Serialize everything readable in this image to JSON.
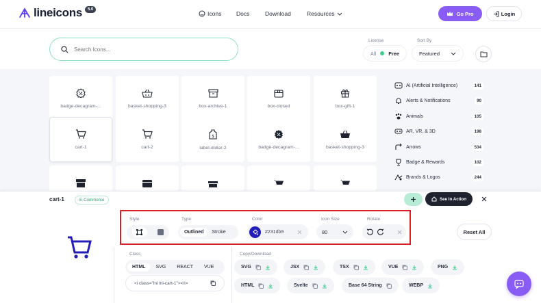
{
  "header": {
    "logo_text": "lineicons",
    "version": "5.0",
    "nav": {
      "icons": "Icons",
      "docs": "Docs",
      "download": "Download",
      "resources": "Resources"
    },
    "go_pro": "Go Pro",
    "login": "Login"
  },
  "search": {
    "placeholder": "Search Icons..."
  },
  "filters": {
    "license_label": "License",
    "license_all": "All",
    "license_free": "Free",
    "sort_label": "Sort By",
    "sort_value": "Featured"
  },
  "tiles": [
    {
      "name": "badge-decagram-...",
      "icon": "badge-percent-icon"
    },
    {
      "name": "basket-shopping-3",
      "icon": "basket-icon"
    },
    {
      "name": "box-archive-1",
      "icon": "archive-icon"
    },
    {
      "name": "box-closed",
      "icon": "box-closed-icon"
    },
    {
      "name": "box-gift-1",
      "icon": "gift-icon"
    },
    {
      "name": "cart-1",
      "icon": "cart-icon"
    },
    {
      "name": "cart-2",
      "icon": "cart-icon"
    },
    {
      "name": "label-dollar-2",
      "icon": "label-dollar-icon"
    },
    {
      "name": "badge-decagram-...",
      "icon": "badge-percent-solid-icon"
    },
    {
      "name": "basket-shopping-3",
      "icon": "basket-solid-icon"
    }
  ],
  "categories": [
    {
      "label": "AI (Artificial Intelligence)",
      "count": "141",
      "icon": "ai-icon"
    },
    {
      "label": "Alerts & Notifications",
      "count": "90",
      "icon": "bell-icon"
    },
    {
      "label": "Animals",
      "count": "105",
      "icon": "paw-icon"
    },
    {
      "label": "AR, VR, & 3D",
      "count": "198",
      "icon": "vr-icon"
    },
    {
      "label": "Arrows",
      "count": "534",
      "icon": "arrow-icon"
    },
    {
      "label": "Badge & Rewards",
      "count": "102",
      "icon": "trophy-icon"
    },
    {
      "label": "Brands & Logos",
      "count": "244",
      "icon": "brand-icon"
    }
  ],
  "detail": {
    "icon_name": "cart-1",
    "category_tag": "E-Commerce",
    "see_in_action": "See In Action",
    "style_label": "Style",
    "type_label": "Type",
    "type_outlined": "Outlined",
    "type_stroke": "Stroke",
    "color_label": "Color",
    "color_value": "#231db9",
    "size_label": "Icon Size",
    "size_value": "80",
    "rotate_label": "Rotate",
    "reset_all": "Reset All",
    "class_label": "Class",
    "class_tabs": [
      "HTML",
      "SVG",
      "REACT",
      "VUE"
    ],
    "class_code": "<i class=\"lni lni-cart-1\"></i>",
    "copy_download_label": "Copy/Download",
    "formats_row1": [
      "SVG",
      "JSX",
      "TSX",
      "VUE",
      "PNG"
    ],
    "formats_row2": [
      "HTML",
      "Svelte",
      "Base 64 String",
      "WEBP"
    ]
  },
  "colors": {
    "accent": "#8a5cf6",
    "icon_color": "#231db9",
    "highlight": "#d81f26",
    "search_border": "#8fe0c2"
  }
}
